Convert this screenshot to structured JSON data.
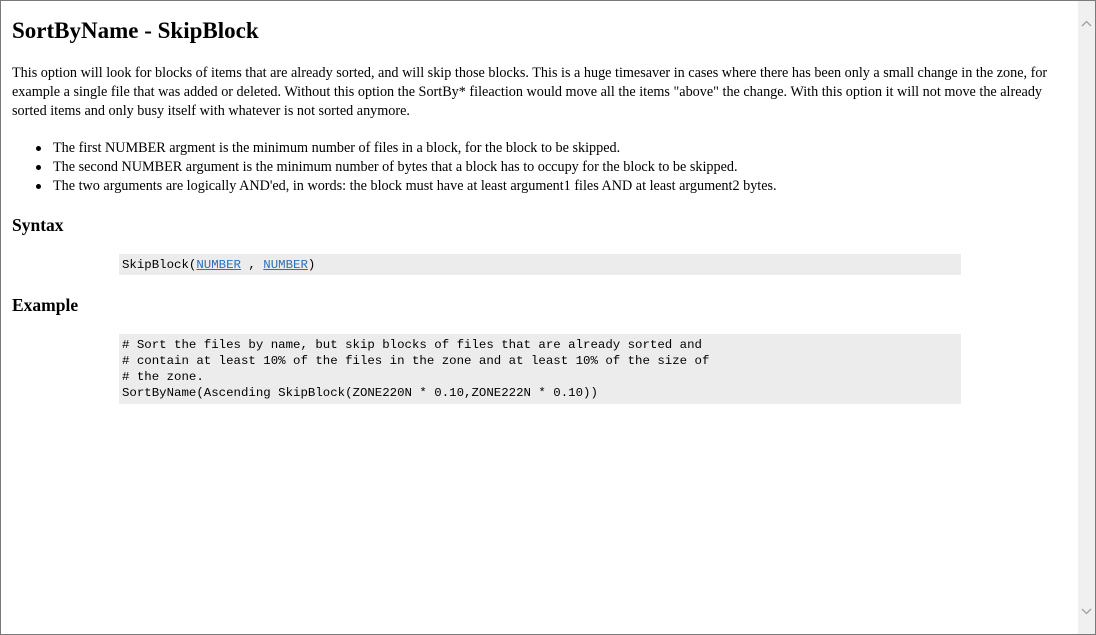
{
  "page": {
    "title": "SortByName - SkipBlock",
    "intro": "This option will look for blocks of items that are already sorted, and will skip those blocks. This is a huge timesaver in cases where there has been only a small change in the zone, for example a single file that was added or deleted. Without this option the SortBy* fileaction would move all the items \"above\" the change. With this option it will not move the already sorted items and only busy itself with whatever is not sorted anymore.",
    "arguments": [
      "The first NUMBER argment is the minimum number of files in a block, for the block to be skipped.",
      "The second NUMBER argument is the minimum number of bytes that a block has to occupy for the block to be skipped.",
      "The two arguments are logically AND'ed, in words: the block must have at least argument1 files AND at least argument2 bytes."
    ]
  },
  "syntax": {
    "heading": "Syntax",
    "prefix": "SkipBlock(",
    "arg1_link": "NUMBER",
    "separator": " , ",
    "arg2_link": "NUMBER",
    "suffix": ")"
  },
  "example": {
    "heading": "Example",
    "lines": [
      "# Sort the files by name, but skip blocks of files that are already sorted and",
      "# contain at least 10% of the files in the zone and at least 10% of the size of",
      "# the zone.",
      "SortByName(Ascending SkipBlock(ZONE220N * 0.10,ZONE222N * 0.10))"
    ]
  },
  "scrollbar": {
    "up_icon": "chevron-up-icon",
    "down_icon": "chevron-down-icon"
  },
  "colors": {
    "link": "#2a6fba",
    "code_background": "#ececec",
    "scrollbar_track": "#f0f0f0"
  }
}
